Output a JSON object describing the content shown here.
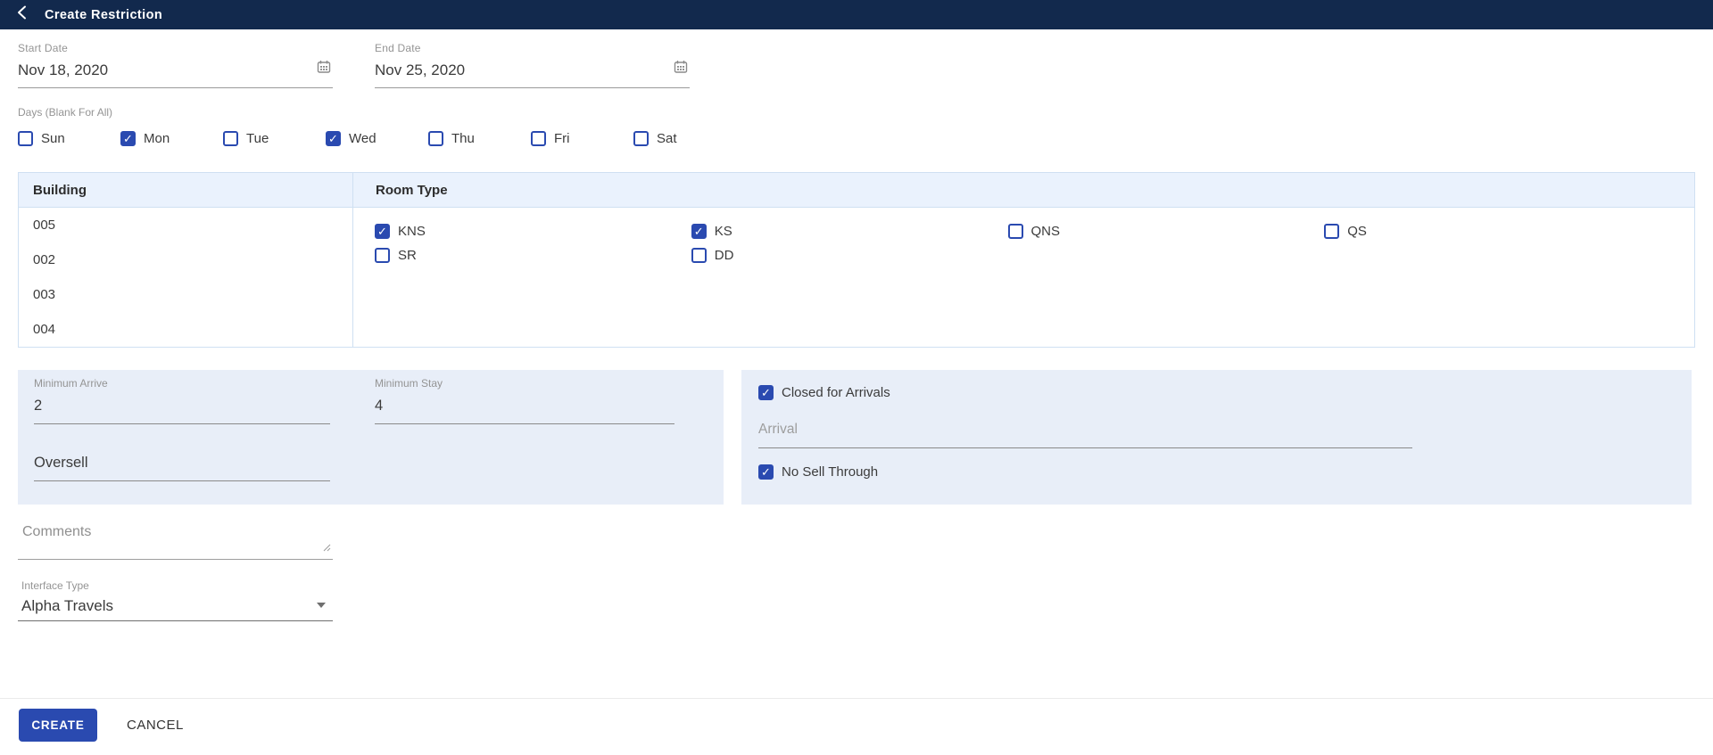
{
  "header": {
    "title": "Create Restriction"
  },
  "form": {
    "start_date": {
      "label": "Start Date",
      "value": "Nov 18, 2020"
    },
    "end_date": {
      "label": "End Date",
      "value": "Nov 25, 2020"
    },
    "days": {
      "label": "Days (Blank For All)",
      "options": [
        {
          "label": "Sun",
          "checked": false
        },
        {
          "label": "Mon",
          "checked": true
        },
        {
          "label": "Tue",
          "checked": false
        },
        {
          "label": "Wed",
          "checked": true
        },
        {
          "label": "Thu",
          "checked": false
        },
        {
          "label": "Fri",
          "checked": false
        },
        {
          "label": "Sat",
          "checked": false
        }
      ]
    },
    "table": {
      "building_header": "Building",
      "room_type_header": "Room Type",
      "buildings": [
        "005",
        "002",
        "003",
        "004"
      ],
      "room_types": [
        {
          "label": "KNS",
          "checked": true
        },
        {
          "label": "KS",
          "checked": true
        },
        {
          "label": "QNS",
          "checked": false
        },
        {
          "label": "QS",
          "checked": false
        },
        {
          "label": "SR",
          "checked": false
        },
        {
          "label": "DD",
          "checked": false
        }
      ]
    },
    "minimum_arrive": {
      "label": "Minimum Arrive",
      "value": "2"
    },
    "minimum_stay": {
      "label": "Minimum Stay",
      "value": "4"
    },
    "oversell": {
      "placeholder": "Oversell",
      "value": ""
    },
    "closed_for_arrivals": {
      "label": "Closed for Arrivals",
      "checked": true
    },
    "arrival": {
      "placeholder": "Arrival",
      "value": ""
    },
    "no_sell_through": {
      "label": "No Sell Through",
      "checked": true
    },
    "comments": {
      "placeholder": "Comments",
      "value": ""
    },
    "interface_type": {
      "label": "Interface Type",
      "value": "Alpha Travels"
    }
  },
  "actions": {
    "create": "CREATE",
    "cancel": "CANCEL"
  },
  "colors": {
    "accent": "#2a4ab0",
    "header_bg": "#12294d",
    "panel_bg": "#e8eef8",
    "table_header_bg": "#eaf2fd",
    "table_border": "#cfe0f2"
  }
}
